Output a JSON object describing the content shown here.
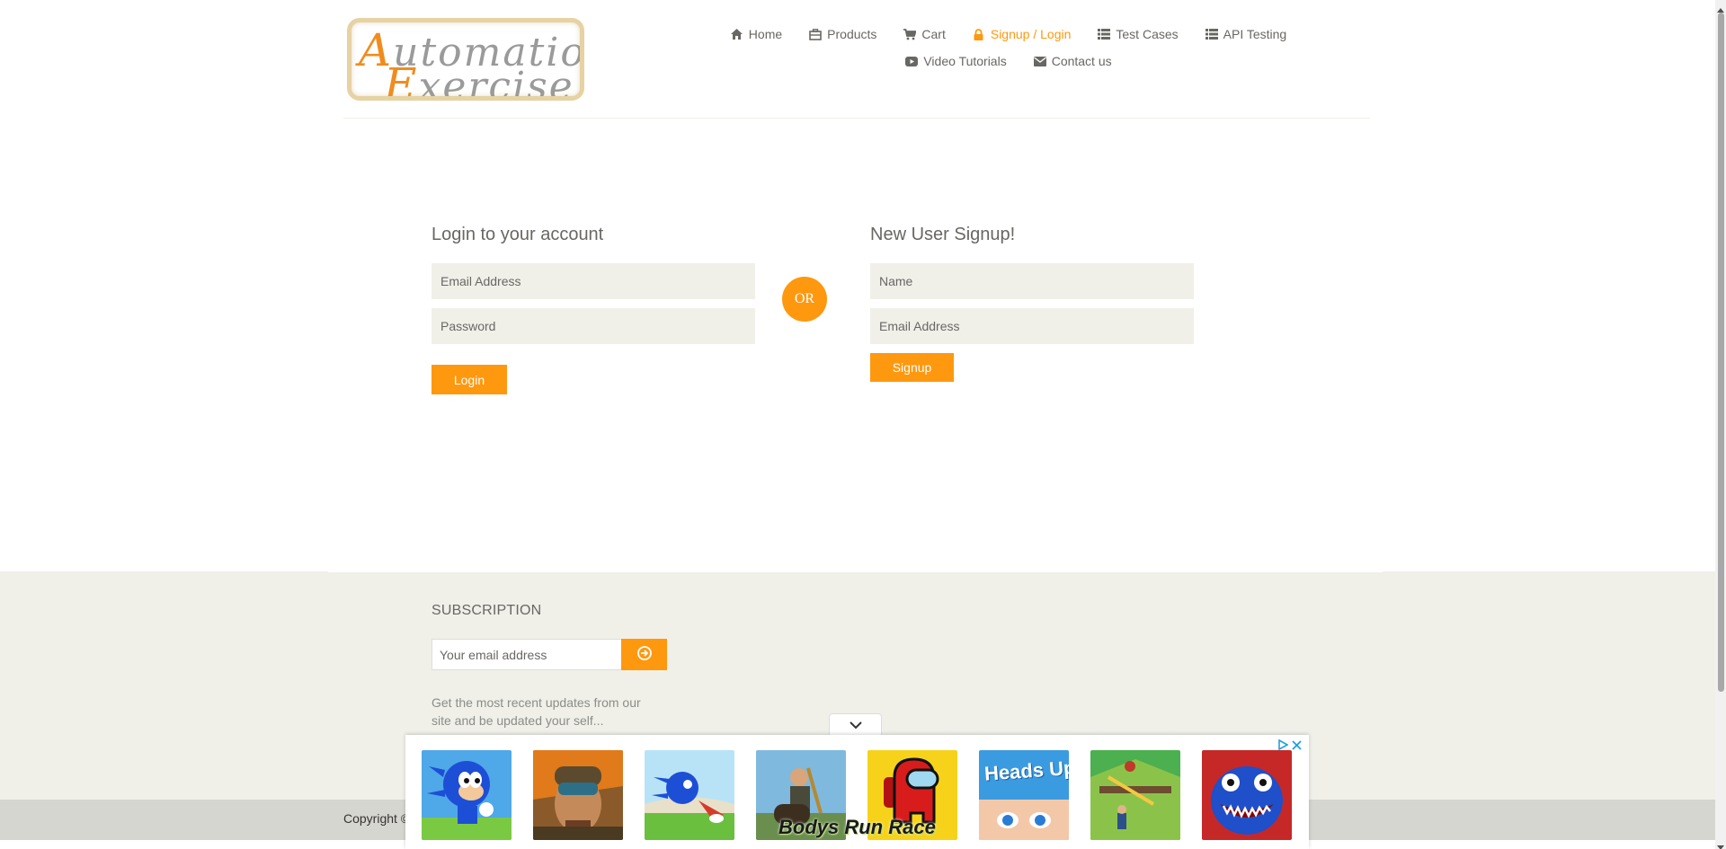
{
  "logo": {
    "line1_cap": "A",
    "line1_rest": "utomation",
    "line2_cap": "E",
    "line2_rest": "xercise"
  },
  "nav": {
    "row1": [
      {
        "label": "Home",
        "icon": "home-icon"
      },
      {
        "label": "Products",
        "icon": "products-icon"
      },
      {
        "label": "Cart",
        "icon": "cart-icon"
      },
      {
        "label": "Signup / Login",
        "icon": "lock-icon",
        "active": true
      },
      {
        "label": "Test Cases",
        "icon": "list-icon"
      },
      {
        "label": "API Testing",
        "icon": "list-icon"
      }
    ],
    "row2": [
      {
        "label": "Video Tutorials",
        "icon": "youtube-icon"
      },
      {
        "label": "Contact us",
        "icon": "envelope-icon"
      }
    ]
  },
  "login": {
    "title": "Login to your account",
    "email_placeholder": "Email Address",
    "password_placeholder": "Password",
    "button": "Login"
  },
  "or_label": "OR",
  "signup": {
    "title": "New User Signup!",
    "name_placeholder": "Name",
    "email_placeholder": "Email Address",
    "button": "Signup"
  },
  "subscription": {
    "title": "SUBSCRIPTION",
    "email_placeholder": "Your email address",
    "description": "Get the most recent updates from our site and be updated your self..."
  },
  "footer": {
    "copyright": "Copyright ©"
  },
  "ad": {
    "caption": "Bodys Run Race",
    "tiles": [
      "sonic-game-icon",
      "soldier-game-icon",
      "sonic-dash-game-icon",
      "climber-game-icon",
      "among-us-game-icon",
      "heads-up-game-icon",
      "pin-puzzle-game-icon",
      "huggy-game-icon"
    ],
    "heads_up_text": "Heads Up!"
  },
  "colors": {
    "accent": "#fe980f",
    "text": "#696763",
    "field_bg": "#f0f0e9",
    "footer_bg": "#f0f0e9",
    "footer_bottom_bg": "#d6d6d0"
  }
}
